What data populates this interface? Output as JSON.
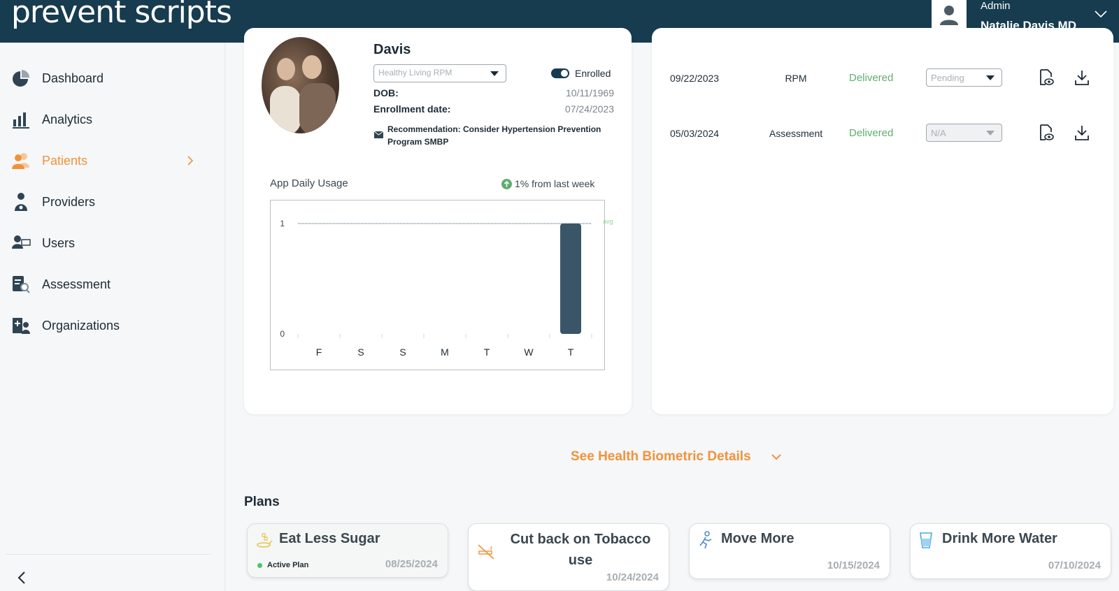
{
  "header": {
    "logo_text": "prevent scripts",
    "logo_mark": "®",
    "user_role": "Admin",
    "user_name": "Natalie Davis MD"
  },
  "sidebar": {
    "items": [
      {
        "label": "Dashboard",
        "icon": "pie-chart-icon"
      },
      {
        "label": "Analytics",
        "icon": "bar-chart-icon"
      },
      {
        "label": "Patients",
        "icon": "patients-icon",
        "active": true
      },
      {
        "label": "Providers",
        "icon": "doctor-icon"
      },
      {
        "label": "Users",
        "icon": "user-card-icon"
      },
      {
        "label": "Assessment",
        "icon": "clipboard-search-icon"
      },
      {
        "label": "Organizations",
        "icon": "hospital-icon"
      }
    ]
  },
  "patient": {
    "name": "Davis",
    "program": "Healthy Living RPM",
    "enrolled_label": "Enrolled",
    "dob_label": "DOB:",
    "dob": "10/11/1969",
    "enrollment_label": "Enrollment date:",
    "enrollment_date": "07/24/2023",
    "recommendation": "Recommendation: Consider Hypertension Prevention Program SMBP"
  },
  "usage": {
    "title": "App Daily Usage",
    "delta": "1% from last week"
  },
  "chart_data": {
    "type": "bar",
    "categories": [
      "F",
      "S",
      "S",
      "M",
      "T",
      "W",
      "T"
    ],
    "values": [
      0,
      0,
      0,
      0,
      0,
      0,
      1
    ],
    "ylim": [
      0,
      1
    ],
    "yticks": [
      "0",
      "1"
    ],
    "avg_label": "avg",
    "avg_value": 1,
    "bar_color": "#3a5568",
    "avg_color": "#8fd49a"
  },
  "reports": [
    {
      "date": "09/22/2023",
      "type": "RPM",
      "status": "Delivered",
      "select": "Pending",
      "disabled": false
    },
    {
      "date": "05/03/2024",
      "type": "Assessment",
      "status": "Delivered",
      "select": "N/A",
      "disabled": true
    }
  ],
  "see_more": "See Health Biometric Details",
  "plans_title": "Plans",
  "plans": [
    {
      "title": "Eat Less Sugar",
      "date": "08/25/2024",
      "status": "Active Plan",
      "icon": "spoon-sugar-icon"
    },
    {
      "title": "Cut back on Tobacco use",
      "date": "10/24/2024",
      "icon": "no-smoking-icon"
    },
    {
      "title": "Move More",
      "date": "10/15/2024",
      "icon": "running-icon"
    },
    {
      "title": "Drink More Water",
      "date": "07/10/2024",
      "icon": "water-glass-icon"
    }
  ],
  "colors": {
    "header_bg": "#173b4f",
    "accent": "#f0923c",
    "success": "#5fae6e"
  }
}
